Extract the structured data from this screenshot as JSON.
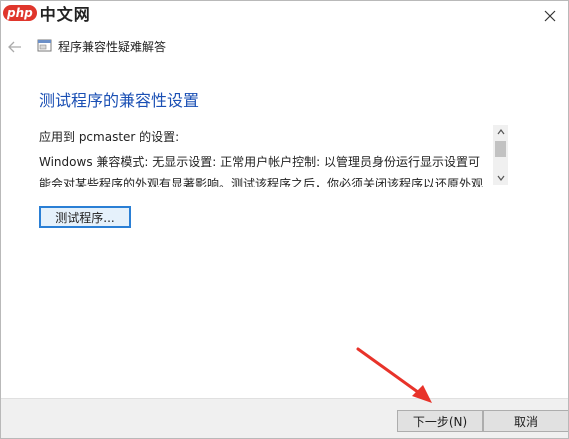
{
  "brand": {
    "badge": "php",
    "text": "中文网"
  },
  "header": {
    "title": "程序兼容性疑难解答"
  },
  "main": {
    "heading": "测试程序的兼容性设置",
    "applied_label": "应用到 pcmaster 的设置:",
    "settings_text": "Windows 兼容模式: 无显示设置: 正常用户帐户控制: 以管理员身份运行显示设置可能会对某些程序的外观有显著影响。测试该程序之后，你必须关闭该程序以还原外观",
    "test_button": "测试程序..."
  },
  "footer": {
    "next_label": "下一步(N)",
    "cancel_label": "取消"
  },
  "colors": {
    "heading": "#1a4fb4",
    "annotation_arrow": "#e8332a",
    "focus_border": "#2a7fd5"
  },
  "icons": {
    "close": "close-icon",
    "back": "back-arrow-icon",
    "app": "program-compat-icon",
    "scroll_up": "chevron-up-icon",
    "scroll_down": "chevron-down-icon"
  }
}
